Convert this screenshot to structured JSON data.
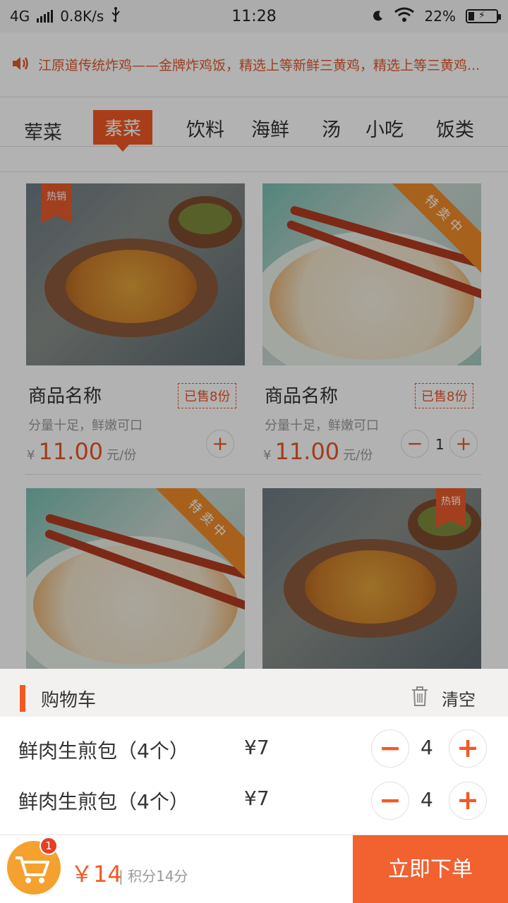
{
  "status_bar": {
    "network": "4G",
    "speed": "0.8K/s",
    "time": "11:28",
    "battery": "22%"
  },
  "notice": {
    "icon": "speaker-icon",
    "text": "江原道传统炸鸡——金牌炸鸡饭，精选上等新鲜三黄鸡，精选上等三黄鸡..."
  },
  "tabs": [
    {
      "label": "荤菜"
    },
    {
      "label": "素菜",
      "active": true
    },
    {
      "label": "饮料"
    },
    {
      "label": "海鲜"
    },
    {
      "label": "汤"
    },
    {
      "label": "小吃"
    },
    {
      "label": "饭类"
    }
  ],
  "products": [
    {
      "name": "商品名称",
      "tag": "热销",
      "sold": "已售8份",
      "desc": "分量十足，鲜嫩可口",
      "yen": "¥",
      "price": "11.00",
      "unit": "元/份",
      "qty": ""
    },
    {
      "name": "商品名称",
      "tag": "特卖中",
      "sold": "已售8份",
      "desc": "分量十足，鲜嫩可口",
      "yen": "¥",
      "price": "11.00",
      "unit": "元/份",
      "qty": "1"
    },
    {
      "tag": "特卖中"
    },
    {
      "tag": "热销"
    }
  ],
  "cart": {
    "title": "购物车",
    "clear_label": "清空",
    "items": [
      {
        "name": "鲜肉生煎包（4个）",
        "price": "¥7",
        "qty": "4"
      },
      {
        "name": "鲜肉生煎包（4个）",
        "price": "¥7",
        "qty": "4"
      }
    ]
  },
  "bottom_bar": {
    "badge_count": "1",
    "total": "￥14",
    "points": "| 积分14分",
    "order_label": "立即下单"
  },
  "colors": {
    "accent": "#f15a24",
    "cart_button": "#f5a12f",
    "sale_ribbon": "#f08c2a"
  }
}
